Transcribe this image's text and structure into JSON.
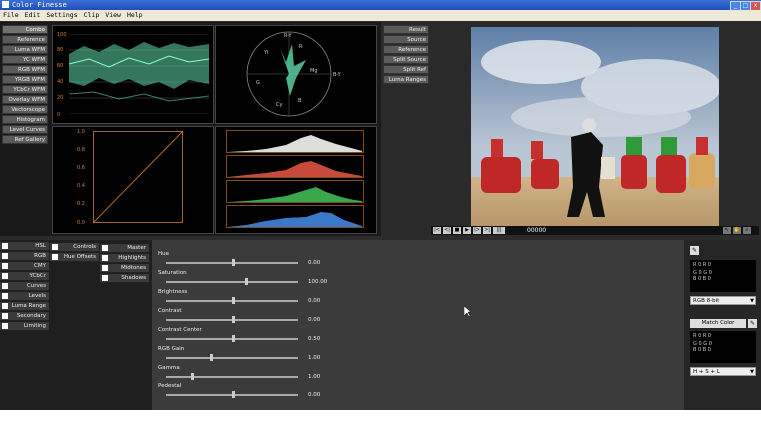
{
  "window": {
    "title": "Color Finesse"
  },
  "menu": [
    "File",
    "Edit",
    "Settings",
    "Clip",
    "View",
    "Help"
  ],
  "scope_buttons": [
    "Combo",
    "Reference",
    "Luma WFM",
    "YC WFM",
    "RGB WFM",
    "YRGB WFM",
    "YCbCr WFM",
    "Overlay WFM",
    "Vectorscope",
    "Histogram",
    "Level Curves",
    "Ref Gallery"
  ],
  "scope_ticks": [
    "100",
    "80",
    "60",
    "40",
    "20",
    "0"
  ],
  "curve_ticks": [
    "1.0",
    "0.8",
    "0.6",
    "0.4",
    "0.2",
    "0.0"
  ],
  "vector_labels": [
    "B-Y",
    "R-Y",
    "R",
    "Mg",
    "B",
    "Cy",
    "G",
    "Yl"
  ],
  "view_buttons": [
    "Result",
    "Source",
    "Reference",
    "Split Source",
    "Split Ref",
    "Luma Ranges"
  ],
  "transport": {
    "buttons": [
      "|<",
      "<|",
      "■",
      "▶",
      "|>",
      ">|",
      "|||"
    ],
    "timecode": "00000"
  },
  "left_tabs": [
    "HSL",
    "RGB",
    "CMY",
    "YCbCr",
    "Curves",
    "Levels",
    "Luma Range",
    "Secondary",
    "Limiting"
  ],
  "mid1_items": [
    "Controls",
    "Hue Offsets"
  ],
  "mid2_items": [
    "Master",
    "Highlights",
    "Midtones",
    "Shadows"
  ],
  "sliders": [
    {
      "label": "Hue",
      "value": "0.00"
    },
    {
      "label": "Saturation",
      "value": "100.00"
    },
    {
      "label": "Brightness",
      "value": "0.00"
    },
    {
      "label": "Contrast",
      "value": "0.00"
    },
    {
      "label": "Contrast Center",
      "value": "0.50"
    },
    {
      "label": "RGB Gain",
      "value": "1.00"
    },
    {
      "label": "Gamma",
      "value": "1.00"
    },
    {
      "label": "Pedestal",
      "value": "0.00"
    }
  ],
  "right_panel": {
    "box1": [
      "R  0  R  0",
      "G  0  G  0",
      "B  0  B  0"
    ],
    "select1": "RGB 8-bit",
    "match_color": "Match Color",
    "box2": [
      "R  0  R  0",
      "G  0  G  0",
      "B  0  B  0"
    ],
    "select2": "H + S + L"
  },
  "colors": {
    "accent": "#4a86e8",
    "panel": "#3b3b3b",
    "scope_green": "#5fd9a8"
  }
}
